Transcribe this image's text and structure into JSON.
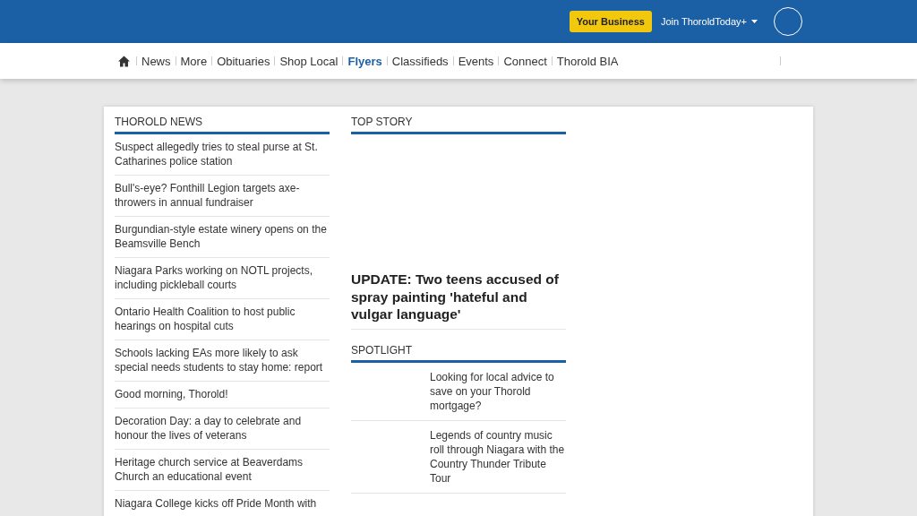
{
  "header": {
    "business_button": "Your Business",
    "join_menu": "Join ThoroldToday+"
  },
  "nav": [
    {
      "label": "News",
      "selected": false
    },
    {
      "label": "More",
      "selected": false
    },
    {
      "label": "Obituaries",
      "selected": false
    },
    {
      "label": "Shop Local",
      "selected": false
    },
    {
      "label": "Flyers",
      "selected": true
    },
    {
      "label": "Classifieds",
      "selected": false
    },
    {
      "label": "Events",
      "selected": false
    },
    {
      "label": "Connect",
      "selected": false
    },
    {
      "label": "Thorold BIA",
      "selected": false
    }
  ],
  "thorold_news": {
    "title": "THOROLD NEWS",
    "items": [
      "Suspect allegedly tries to steal purse at St. Catharines police station",
      "Bull's-eye? Fonthill Legion targets axe-throwers in annual fundraiser",
      "Burgundian-style estate winery opens on the Beamsville Bench",
      "Niagara Parks working on NOTL projects, including pickleball courts",
      "Ontario Health Coalition to host public hearings on hospital cuts",
      "Schools lacking EAs more likely to ask special needs students to stay home: report",
      "Good morning, Thorold!",
      "Decoration Day: a day to celebrate and honour the lives of veterans",
      "Heritage church service at Beaverdams Church an educational event",
      "Niagara College kicks off Pride Month with"
    ]
  },
  "top_story": {
    "title": "TOP STORY",
    "headline": "UPDATE: Two teens accused of spray painting 'hateful and vulgar language'"
  },
  "spotlight": {
    "title": "SPOTLIGHT",
    "items": [
      "Looking for local advice to save on your Thorold mortgage?",
      "Legends of country music roll through Niagara with the Country Thunder Tribute Tour"
    ]
  }
}
